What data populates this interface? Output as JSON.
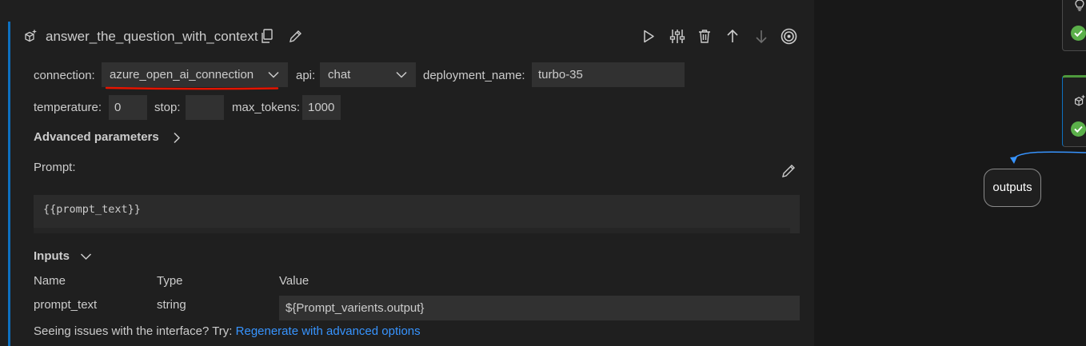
{
  "node": {
    "title": "answer_the_question_with_context"
  },
  "toolbar": {
    "icons": [
      "run-icon",
      "tune-icon",
      "delete-icon",
      "arrow-up-icon",
      "arrow-down-icon",
      "target-icon"
    ]
  },
  "params": {
    "connection_label": "connection:",
    "connection_value": "azure_open_ai_connection",
    "api_label": "api:",
    "api_value": "chat",
    "deployment_label": "deployment_name:",
    "deployment_value": "turbo-35",
    "temperature_label": "temperature:",
    "temperature_value": "0",
    "stop_label": "stop:",
    "stop_value": "",
    "max_tokens_label": "max_tokens:",
    "max_tokens_value": "1000"
  },
  "advanced": {
    "label": "Advanced parameters"
  },
  "prompt": {
    "label": "Prompt:",
    "text": "{{prompt_text}}"
  },
  "inputs": {
    "label": "Inputs",
    "headers": {
      "name": "Name",
      "type": "Type",
      "value": "Value"
    },
    "rows": [
      {
        "name": "prompt_text",
        "type": "string",
        "value": "${Prompt_varients.output}"
      }
    ]
  },
  "footer": {
    "issues_text": "Seeing issues with the interface? Try:",
    "link_text": "Regenerate with advanced options"
  },
  "canvas": {
    "outputs_label": "outputs"
  },
  "colors": {
    "accent": "#0e70c0",
    "link": "#3794ff",
    "success": "#5bb04a",
    "underline": "#e51400"
  }
}
